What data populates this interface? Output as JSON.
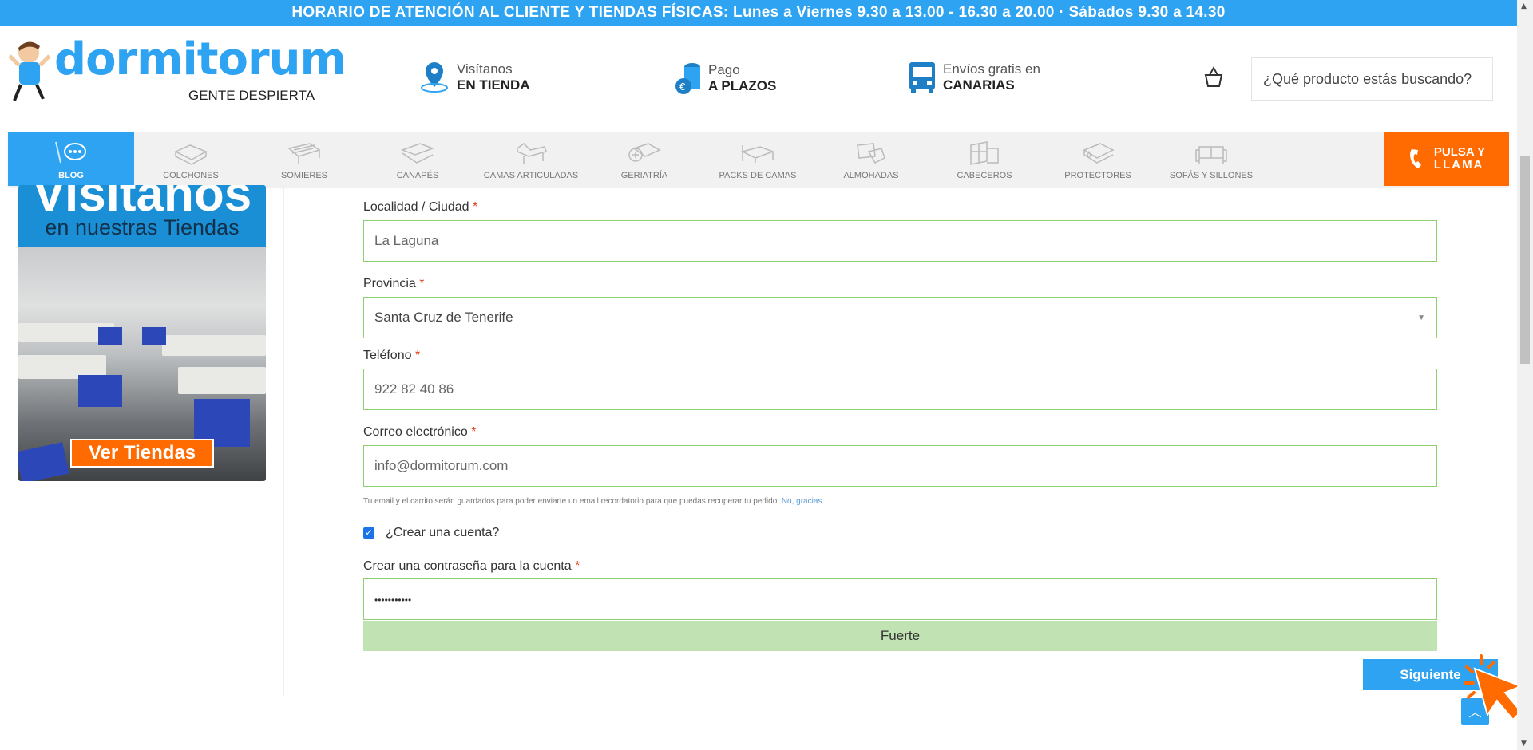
{
  "topbar": {
    "text": "HORARIO DE ATENCIÓN AL CLIENTE Y TIENDAS FÍSICAS: Lunes a Viernes 9.30 a 13.00 - 16.30 a 20.00 · Sábados 9.30 a 14.30"
  },
  "header": {
    "logo": {
      "name": "dormitorum",
      "tagline": "GENTE DESPIERTA"
    },
    "features": [
      {
        "icon": "map-pin-icon",
        "line1": "Visítanos",
        "line2": "EN TIENDA"
      },
      {
        "icon": "coins-icon",
        "line1": "Pago",
        "line2": "A PLAZOS"
      },
      {
        "icon": "truck-icon",
        "line1": "Envíos gratis en",
        "line2": "CANARIAS"
      }
    ],
    "search": {
      "placeholder": "¿Qué producto estás buscando?"
    }
  },
  "nav": {
    "items": [
      "BLOG",
      "COLCHONES",
      "SOMIERES",
      "CANAPÉS",
      "CAMAS ARTICULADAS",
      "GERIATRÍA",
      "PACKS DE CAMAS",
      "ALMOHADAS",
      "CABECEROS",
      "PROTECTORES",
      "SOFÁS Y SILLONES"
    ],
    "call": {
      "line1": "PULSA Y",
      "line2": "LLAMA"
    }
  },
  "banner": {
    "title": "Visítanos",
    "subtitle": "en nuestras Tiendas",
    "button": "Ver Tiendas"
  },
  "form": {
    "city": {
      "label": "Localidad / Ciudad",
      "value": "La Laguna"
    },
    "province": {
      "label": "Provincia",
      "value": "Santa Cruz de Tenerife"
    },
    "phone": {
      "label": "Teléfono",
      "value": "922 82 40 86"
    },
    "email": {
      "label": "Correo electrónico",
      "value": "info@dormitorum.com"
    },
    "note": "Tu email y el carrito serán guardados para poder enviarte un email recordatorio para que puedas recuperar tu pedido.",
    "note_link": "No, gracias",
    "create_account": {
      "label": "¿Crear una cuenta?",
      "checked": true
    },
    "password": {
      "label": "Crear una contraseña para la cuenta",
      "value": "•••••••••••"
    },
    "strength": "Fuerte",
    "required_mark": "*",
    "next_button": "Siguiente"
  },
  "colors": {
    "brand": "#2ea3f2",
    "accent": "#ff6b00",
    "valid_border": "#8fcf6d",
    "strength_bg": "#c1e2b3"
  }
}
